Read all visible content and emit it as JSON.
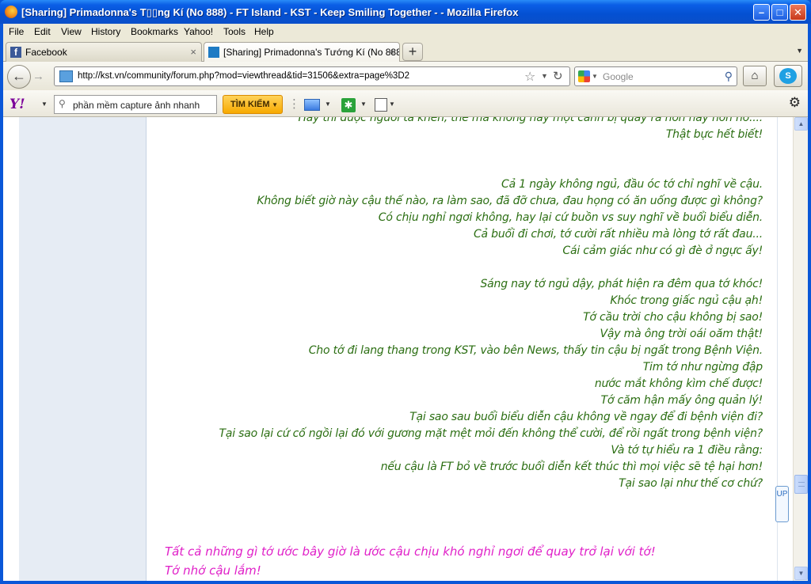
{
  "window": {
    "title": "[Sharing] Primadonna's T▯▯ng Kí (No 888) - FT Island - KST - Keep Smiling Together - - Mozilla Firefox",
    "minimize": "–",
    "maximize": "□",
    "close": "✕"
  },
  "menu": {
    "file": "File",
    "edit": "Edit",
    "view": "View",
    "history": "History",
    "bookmarks": "Bookmarks",
    "yahoo": "Yahoo!",
    "tools": "Tools",
    "help": "Help"
  },
  "tabs": [
    {
      "label": "Facebook",
      "icon": "facebook-icon"
    },
    {
      "label": "[Sharing] Primadonna's Tướng Kí (No 888...",
      "icon": "kst-site-icon"
    }
  ],
  "tab_close": "×",
  "new_tab": "+",
  "nav": {
    "url": "http://kst.vn/community/forum.php?mod=viewthread&tid=31506&extra=page%3D2",
    "search_placeholder": "Google"
  },
  "yahoo_toolbar": {
    "logo": "Y!",
    "search_value": "phần mềm capture ảnh nhanh",
    "search_button": "TÌM KIẾM"
  },
  "post": {
    "lines": [
      "Hay thì được người ta khen, thế mà không hay một cảnh bị quay ra hơn hay hơn nớ....",
      "Thật bực hết biết!",
      "Cả 1 ngày không ngủ, đầu óc tớ chỉ nghĩ về cậu.",
      "Không biết giờ này cậu thế nào, ra làm sao, đã đỡ chưa, đau họng có ăn uống được gì không?",
      "Có chịu nghỉ ngơi không, hay lại cứ buồn vs suy nghĩ về buổi biểu diễn.",
      "Cả buổi đi chơi, tớ cười rất nhiều mà lòng tớ rất đau...",
      "Cái cảm giác như có gì đè ở ngực ấy!",
      "Sáng nay tớ ngủ dậy, phát hiện ra đêm qua tớ khóc!",
      "Khóc trong giấc ngủ cậu ạh!",
      "Tớ cầu trời cho cậu không bị sao!",
      "Vậy mà ông trời oái oăm thật!",
      "Cho tớ đi lang thang trong KST, vào bên News, thấy tin cậu bị ngất trong Bệnh Viện.",
      "Tim tớ như ngừng đập",
      "nước mắt không kìm chế được!",
      "Tớ căm hận mấy ông quản lý!",
      "Tại sao sau buổi biểu diễn cậu không về ngay để đi bệnh viện đi?",
      "Tại sao lại cứ cố ngồi lại đó với gương mặt mệt mỏi đến không thể cười, để rồi ngất trong bệnh viện?",
      "Và tớ tự hiểu ra 1 điều rằng:",
      "nếu cậu là FT bỏ về trước buổi diễn kết thúc thì mọi việc sẽ tệ hại hơn!",
      "Tại sao lại như thế cơ chứ?"
    ],
    "pink_lines": [
      "Tất cả những gì tớ ước bây giờ là ước cậu chịu khó nghỉ ngơi để quay trở lại với tớ!",
      "Tớ nhớ cậu lắm!"
    ],
    "up_tab": "UP"
  },
  "colors": {
    "post_text": "#2b6e12",
    "pink_text": "#e020c8",
    "titlebar": "#0450d2"
  }
}
